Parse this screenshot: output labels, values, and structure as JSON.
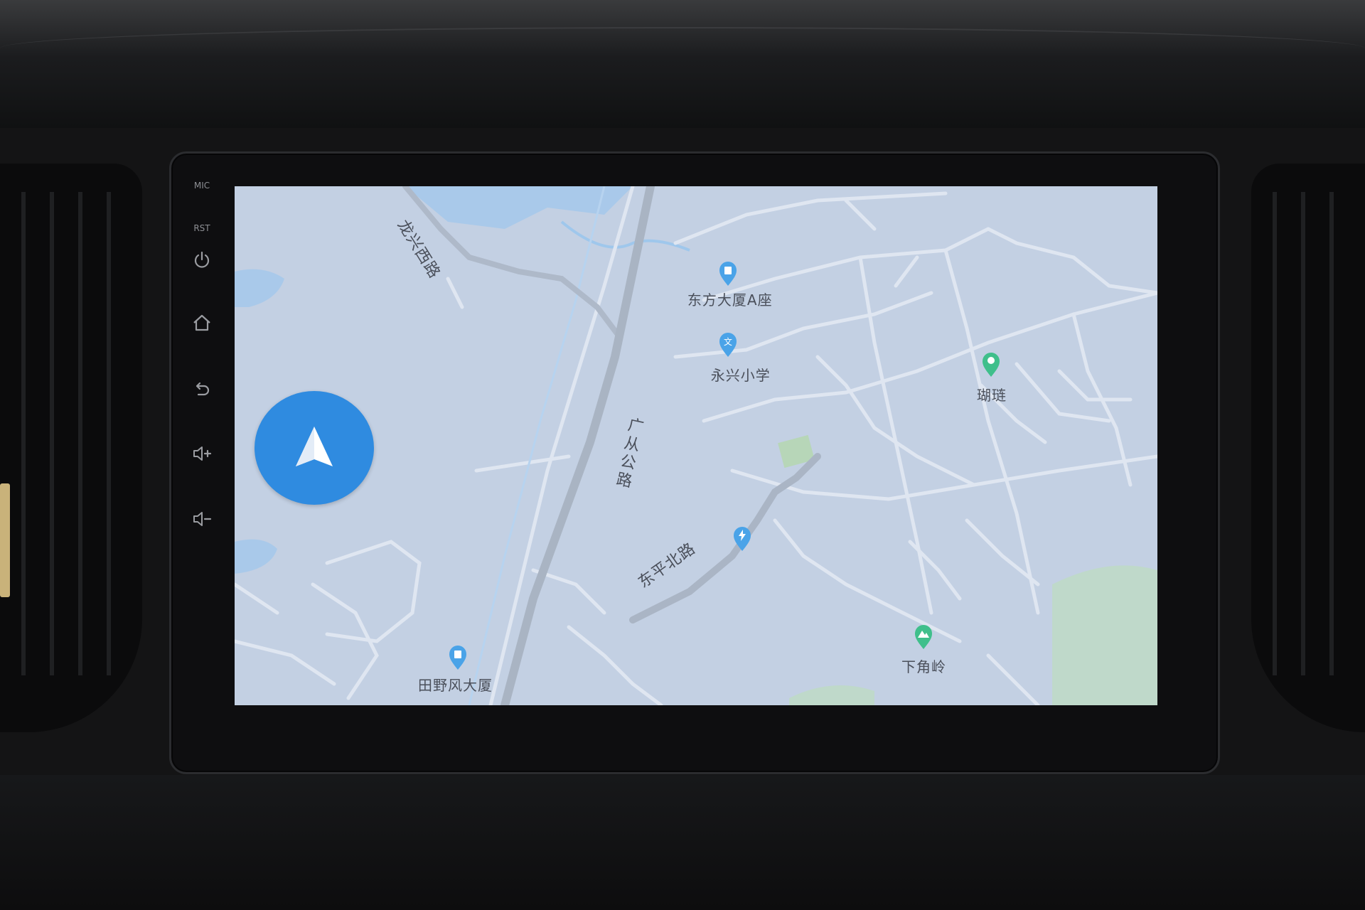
{
  "device": {
    "buttons": [
      {
        "name": "mic",
        "label": "MIC"
      },
      {
        "name": "rst",
        "label": "RST"
      },
      {
        "name": "power",
        "icon": "power-icon"
      },
      {
        "name": "home",
        "icon": "home-icon"
      },
      {
        "name": "back",
        "icon": "back-icon"
      },
      {
        "name": "volume-up",
        "icon": "volume-up-icon"
      },
      {
        "name": "volume-down",
        "icon": "volume-down-icon"
      }
    ]
  },
  "map": {
    "roads": {
      "longxing_west": "龙兴西路",
      "guangcong": "广从公路",
      "dongping_north": "东平北路"
    },
    "pois": {
      "dongfang": "东方大厦A座",
      "yongxing": "永兴小学",
      "hulian": "瑚琏",
      "tianye": "田野风大厦",
      "xiajiaoling": "下角岭"
    },
    "colors": {
      "background": "#c3d0e3",
      "road": "#dfe6f1",
      "highway": "#a9b4c3",
      "water": "#9fc7ec",
      "green": "#b9d9c4",
      "pin_blue": "#4aa3e8",
      "pin_green": "#3fbf8b",
      "nav_button": "#2f8be0"
    },
    "nav_icon": "navigation-arrow-icon"
  }
}
